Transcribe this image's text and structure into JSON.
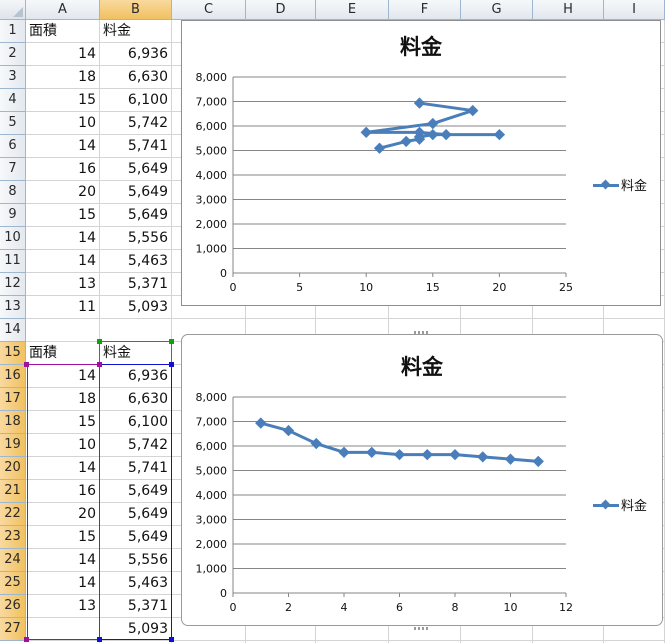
{
  "columns": [
    "A",
    "B",
    "C",
    "D",
    "E",
    "F",
    "G",
    "H",
    "I"
  ],
  "rows": [
    "1",
    "2",
    "3",
    "4",
    "5",
    "6",
    "7",
    "8",
    "9",
    "10",
    "11",
    "12",
    "13",
    "14",
    "15",
    "16",
    "17",
    "18",
    "19",
    "20",
    "21",
    "22",
    "23",
    "24",
    "25",
    "26",
    "27"
  ],
  "table1": {
    "header": [
      "面積",
      "料金"
    ],
    "area": [
      "14",
      "18",
      "15",
      "10",
      "14",
      "16",
      "20",
      "15",
      "14",
      "14",
      "13",
      "11"
    ],
    "fee": [
      "6,936",
      "6,630",
      "6,100",
      "5,742",
      "5,741",
      "5,649",
      "5,649",
      "5,649",
      "5,556",
      "5,463",
      "5,371",
      "5,093"
    ]
  },
  "table2": {
    "header": [
      "面積",
      "料金"
    ],
    "area": [
      "14",
      "18",
      "15",
      "10",
      "14",
      "16",
      "20",
      "15",
      "14",
      "14",
      "13",
      ""
    ],
    "fee": [
      "6,936",
      "6,630",
      "6,100",
      "5,742",
      "5,741",
      "5,649",
      "5,649",
      "5,649",
      "5,556",
      "5,463",
      "5,371",
      "5,093"
    ]
  },
  "chart_data": [
    {
      "type": "scatter",
      "title": "料金",
      "series": [
        {
          "name": "料金",
          "x": [
            14,
            18,
            15,
            10,
            14,
            16,
            20,
            15,
            14,
            14,
            13,
            11
          ],
          "y": [
            6936,
            6630,
            6100,
            5742,
            5741,
            5649,
            5649,
            5649,
            5556,
            5463,
            5371,
            5093
          ]
        }
      ],
      "xlim": [
        0,
        25
      ],
      "xticks": [
        "0",
        "5",
        "10",
        "15",
        "20",
        "25"
      ],
      "ylim": [
        0,
        8000
      ],
      "yticks": [
        "0",
        "1,000",
        "2,000",
        "3,000",
        "4,000",
        "5,000",
        "6,000",
        "7,000",
        "8,000"
      ],
      "grid": true,
      "legend": "right",
      "color": "#4a7ebb"
    },
    {
      "type": "scatter",
      "title": "料金",
      "series": [
        {
          "name": "料金",
          "x": [
            1,
            2,
            3,
            4,
            5,
            6,
            7,
            8,
            9,
            10,
            11
          ],
          "y": [
            6936,
            6630,
            6100,
            5742,
            5741,
            5649,
            5649,
            5649,
            5556,
            5463,
            5371
          ]
        }
      ],
      "xlim": [
        0,
        12
      ],
      "xticks": [
        "0",
        "2",
        "4",
        "6",
        "8",
        "10",
        "12"
      ],
      "ylim": [
        0,
        8000
      ],
      "yticks": [
        "0",
        "1,000",
        "2,000",
        "3,000",
        "4,000",
        "5,000",
        "6,000",
        "7,000",
        "8,000"
      ],
      "grid": true,
      "legend": "right",
      "color": "#4a7ebb"
    }
  ]
}
